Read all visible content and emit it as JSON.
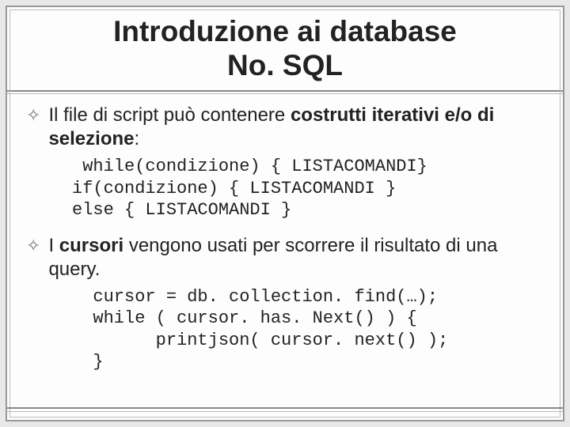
{
  "title_line1": "Introduzione ai database",
  "title_line2": "No. SQL",
  "bullets": [
    {
      "pre": "Il file di script può contenere ",
      "bold": "costrutti iterativi e/o di selezione",
      "post": ":",
      "code": " while(condizione) { LISTACOMANDI}\nif(condizione) { LISTACOMANDI }\nelse { LISTACOMANDI }"
    },
    {
      "pre": "I ",
      "bold": "cursori",
      "post": " vengono usati per scorrere il risultato di una query.",
      "code": "  cursor = db. collection. find(…);\n  while ( cursor. has. Next() ) {\n        printjson( cursor. next() );\n  }"
    }
  ]
}
